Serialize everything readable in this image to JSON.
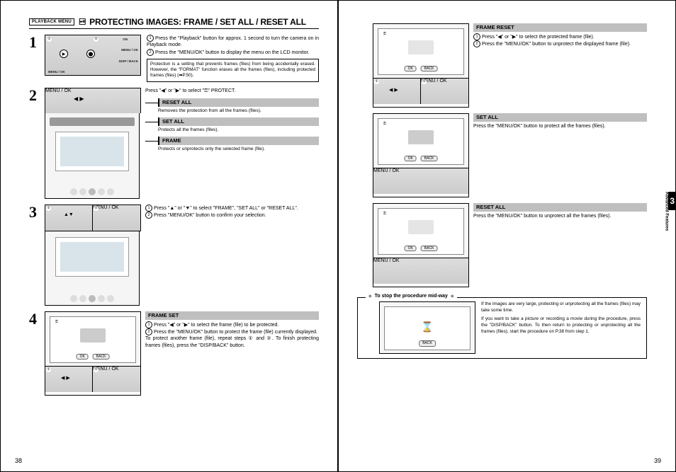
{
  "header": {
    "menu_tag": "PLAYBACK MENU",
    "title": "PROTECTING IMAGES: FRAME / SET ALL / RESET ALL"
  },
  "left": {
    "step1": {
      "p1": "Press the \"Playback\" button for approx. 1 second to turn the camera on in Playback mode.",
      "p2": "Press the \"MENU/OK\" button to display the menu on the LCD monitor.",
      "note": "Protection is a setting that prevents frames (files) from being accidentally erased. However, the \"FORMAT\" function erases all the frames (files), including protected frames (files) (➡P.50)."
    },
    "step2": {
      "intro": "Press \"◀\" or \"▶\" to select \"⚿\" PROTECT.",
      "reset_all_lbl": "RESET ALL",
      "reset_all_txt": "Removes the protection from all the frames (files).",
      "set_all_lbl": "SET ALL",
      "set_all_txt": "Protects all the frames (files).",
      "frame_lbl": "FRAME",
      "frame_txt": "Protects or unprotects only the selected frame (file)."
    },
    "step3": {
      "p1": "Press \"▲\" or \"▼\" to select \"FRAME\", \"SET ALL\" or \"RESET ALL\".",
      "p2": "Press \"MENU/OK\" button to confirm your selection."
    },
    "step4": {
      "frame_set_lbl": "FRAME SET",
      "p1": "Press \"◀\" or \"▶\" to select the frame (file) to be protected.",
      "p2": "Press the \"MENU/OK\" button to protect the frame (file) currently displayed.",
      "p3": "To protect another frame (file), repeat steps ① and ②. To finish protecting frames (files), press the \"DISP/BACK\" button."
    },
    "page_num": "38"
  },
  "right": {
    "frame_reset": {
      "lbl": "FRAME RESET",
      "p1": "Press \"◀\" or \"▶\" to select the protected frame (file).",
      "p2": "Press the \"MENU/OK\" button to unprotect the displayed frame (file)."
    },
    "set_all": {
      "lbl": "SET ALL",
      "txt": "Press the \"MENU/OK\" button to protect all the frames (files)."
    },
    "reset_all": {
      "lbl": "RESET ALL",
      "txt": "Press the \"MENU/OK\" button to unprotect all the frames (files)."
    },
    "tip": {
      "title": "To stop the procedure mid-way",
      "p1": "If the images are very large, protecting or unprotecting all the frames (files) may take some time.",
      "p2": "If you want to take a picture or recording a movie during the procedure, press the \"DISP/BACK\" button. To then return to protecting or unprotecting all the frames (files), start the procedure on P.38 from step 1."
    },
    "side_num": "3",
    "side_txt": "Advanced Features",
    "page_num": "39"
  },
  "ui": {
    "ok": "OK",
    "back": "BACK",
    "menu_ok": "MENU / OK",
    "disp_back": "DISP / BACK",
    "on": "ON",
    "key_icon": "⚿"
  }
}
